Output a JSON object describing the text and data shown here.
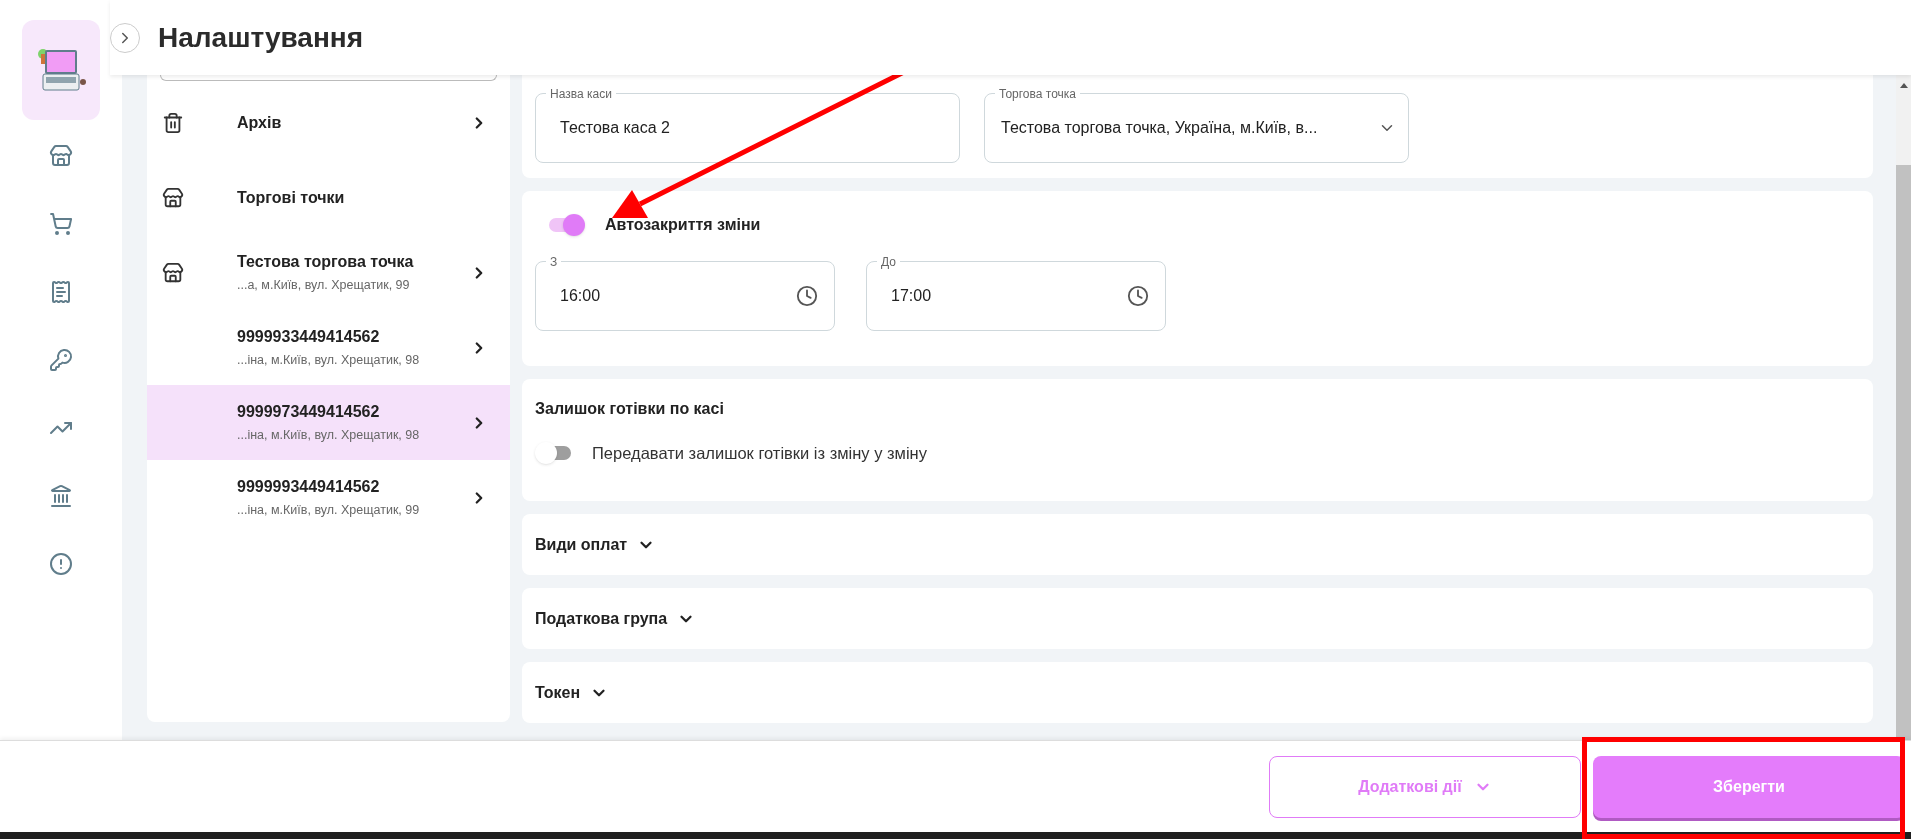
{
  "header": {
    "title": "Налаштування"
  },
  "list": {
    "items": [
      {
        "kind": "archive",
        "title": "Архів",
        "expandable": true,
        "selected": false
      },
      {
        "kind": "stores",
        "title": "Торгові точки",
        "expandable": false,
        "selected": false
      },
      {
        "kind": "store",
        "title": "Тестова торгова точка",
        "subtitle": "...а, м.Київ, вул. Хрещатик, 99",
        "expandable": true,
        "selected": false
      },
      {
        "kind": "register",
        "title": "9999933449414562",
        "subtitle": "...іна, м.Київ, вул. Хрещатик, 98",
        "expandable": true,
        "selected": false
      },
      {
        "kind": "register",
        "title": "9999973449414562",
        "subtitle": "...іна, м.Київ, вул. Хрещатик, 98",
        "expandable": true,
        "selected": true
      },
      {
        "kind": "register",
        "title": "9999993449414562",
        "subtitle": "...іна, м.Київ, вул. Хрещатик, 99",
        "expandable": true,
        "selected": false
      }
    ]
  },
  "form": {
    "name_field": {
      "label": "Назва каси",
      "value": "Тестова каса 2"
    },
    "store_select": {
      "label": "Торгова точка",
      "value": "Тестова торгова точка, Україна, м.Київ, в..."
    },
    "auto_close": {
      "label": "Автозакриття зміни",
      "on": true,
      "from": {
        "label": "З",
        "value": "16:00"
      },
      "to": {
        "label": "До",
        "value": "17:00"
      }
    },
    "cash": {
      "title": "Залишок готівки по касі",
      "toggle": {
        "label": "Передавати залишок готівки із зміну у зміну",
        "on": false
      }
    },
    "sections": [
      {
        "title": "Види оплат",
        "expanded": false
      },
      {
        "title": "Податкова група",
        "expanded": false
      },
      {
        "title": "Токен",
        "expanded": false
      }
    ]
  },
  "footer": {
    "more_button": "Додаткові дії",
    "save_button": "Зберегти"
  }
}
